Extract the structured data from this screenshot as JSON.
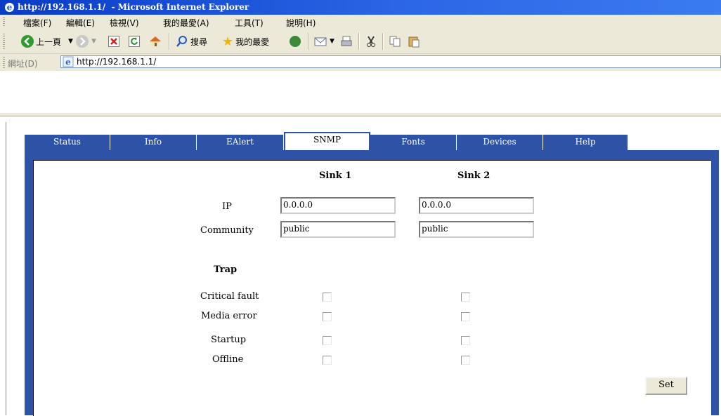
{
  "window": {
    "title": "http://192.168.1.1/  - Microsoft Internet Explorer"
  },
  "menu": {
    "items": [
      "檔案(F)",
      "編輯(E)",
      "檢視(V)",
      "我的最愛(A)",
      "工具(T)",
      "說明(H)"
    ]
  },
  "toolbar": {
    "back_label": "上一頁",
    "search_label": "搜尋",
    "favorites_label": "我的最愛"
  },
  "address": {
    "label": "網址(D)",
    "url": "http://192.168.1.1/"
  },
  "tabs": [
    "Status",
    "Info",
    "EAlert",
    "SNMP",
    "Fonts",
    "Devices",
    "Help"
  ],
  "active_tab": "SNMP",
  "snmp": {
    "sink1_header": "Sink 1",
    "sink2_header": "Sink 2",
    "ip_label": "IP",
    "community_label": "Community",
    "sink1_ip": "0.0.0.0",
    "sink2_ip": "0.0.0.0",
    "sink1_community": "public",
    "sink2_community": "public",
    "trap_header": "Trap",
    "traps": [
      {
        "label": "Critical fault",
        "sink1": false,
        "sink2": false
      },
      {
        "label": "Media error",
        "sink1": false,
        "sink2": false
      },
      {
        "label": "Startup",
        "sink1": false,
        "sink2": false
      },
      {
        "label": "Offline",
        "sink1": false,
        "sink2": false
      }
    ],
    "set_label": "Set"
  },
  "colors": {
    "tab_blue": "#2e53a6",
    "titlebar_blue": "#0a3bc6",
    "chrome": "#ece9d8"
  }
}
